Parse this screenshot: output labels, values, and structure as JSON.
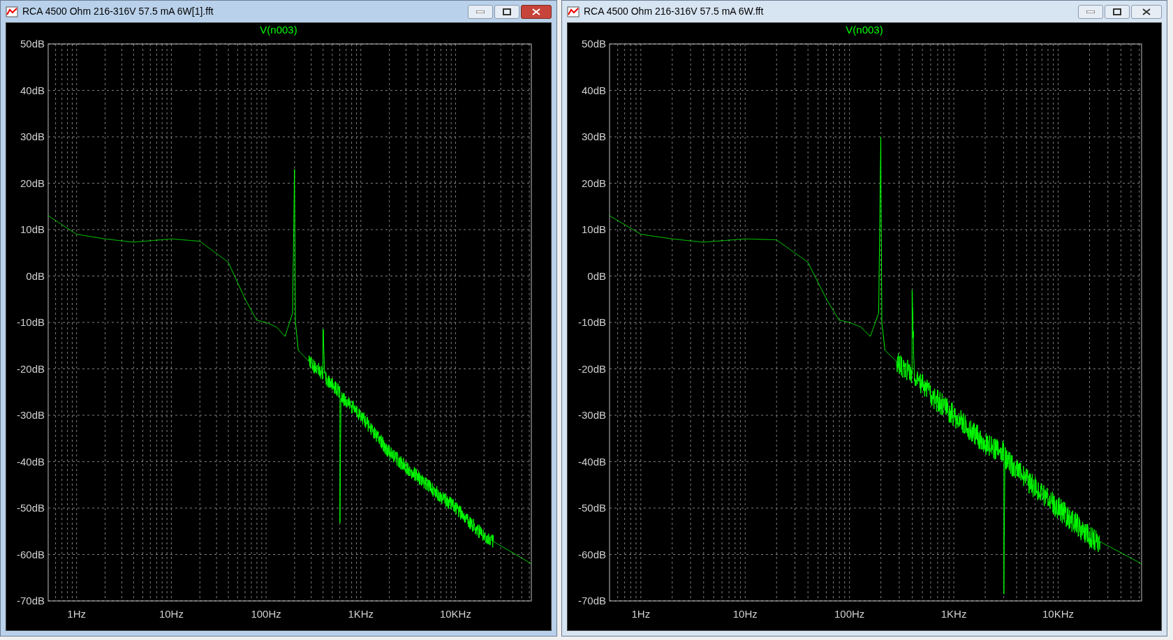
{
  "windows": [
    {
      "title": "RCA 4500 Ohm 216-316V 57.5 mA 6W[1].fft",
      "active": true,
      "plot": {
        "trace_label": "V(n003)",
        "y_axis_labels": [
          "50dB",
          "40dB",
          "30dB",
          "20dB",
          "10dB",
          "0dB",
          "-10dB",
          "-20dB",
          "-30dB",
          "-40dB",
          "-50dB",
          "-60dB",
          "-70dB"
        ],
        "x_axis_labels": [
          "1Hz",
          "10Hz",
          "100Hz",
          "1KHz",
          "10KHz"
        ]
      }
    },
    {
      "title": "RCA 4500 Ohm 216-316V 57.5 mA 6W.fft",
      "active": false,
      "plot": {
        "trace_label": "V(n003)",
        "y_axis_labels": [
          "50dB",
          "40dB",
          "30dB",
          "20dB",
          "10dB",
          "0dB",
          "-10dB",
          "-20dB",
          "-30dB",
          "-40dB",
          "-50dB",
          "-60dB",
          "-70dB"
        ],
        "x_axis_labels": [
          "1Hz",
          "10Hz",
          "100Hz",
          "1KHz",
          "10KHz"
        ]
      }
    }
  ]
}
